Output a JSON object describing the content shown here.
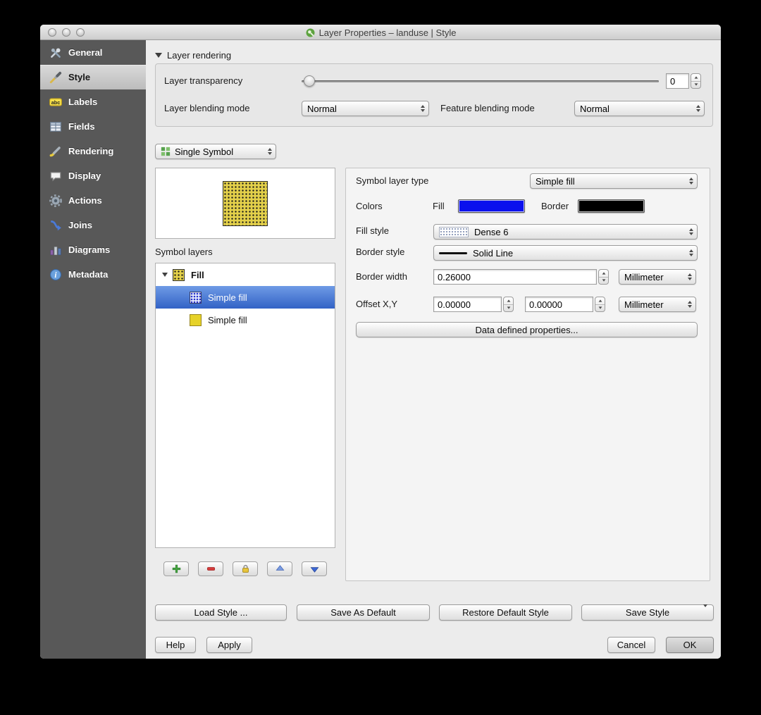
{
  "window": {
    "title": "Layer Properties – landuse | Style"
  },
  "sidebar": {
    "items": [
      {
        "label": "General"
      },
      {
        "label": "Style"
      },
      {
        "label": "Labels"
      },
      {
        "label": "Fields"
      },
      {
        "label": "Rendering"
      },
      {
        "label": "Display"
      },
      {
        "label": "Actions"
      },
      {
        "label": "Joins"
      },
      {
        "label": "Diagrams"
      },
      {
        "label": "Metadata"
      }
    ]
  },
  "layer_rendering": {
    "header": "Layer rendering",
    "transparency_label": "Layer transparency",
    "transparency_value": "0",
    "layer_blending_label": "Layer blending mode",
    "layer_blending_value": "Normal",
    "feature_blending_label": "Feature blending mode",
    "feature_blending_value": "Normal"
  },
  "renderer": {
    "value": "Single Symbol"
  },
  "symbols": {
    "panel_label": "Symbol layers",
    "tree": [
      {
        "label": "Fill"
      },
      {
        "label": "Simple fill"
      },
      {
        "label": "Simple fill"
      }
    ]
  },
  "properties": {
    "type_label": "Symbol layer type",
    "type_value": "Simple fill",
    "colors_label": "Colors",
    "fill_label": "Fill",
    "border_label": "Border",
    "fill_color": "#0a10ee",
    "border_color": "#000000",
    "fill_style_label": "Fill style",
    "fill_style_value": "Dense 6",
    "border_style_label": "Border style",
    "border_style_value": "Solid Line",
    "border_width_label": "Border width",
    "border_width_value": "0.26000",
    "border_width_unit": "Millimeter",
    "offset_label": "Offset X,Y",
    "offset_x": "0.00000",
    "offset_y": "0.00000",
    "offset_unit": "Millimeter",
    "data_defined_label": "Data defined properties..."
  },
  "style_actions": {
    "load": "Load Style ...",
    "save_default": "Save As Default",
    "restore": "Restore Default Style",
    "save": "Save Style"
  },
  "dialog_actions": {
    "help": "Help",
    "apply": "Apply",
    "cancel": "Cancel",
    "ok": "OK"
  }
}
